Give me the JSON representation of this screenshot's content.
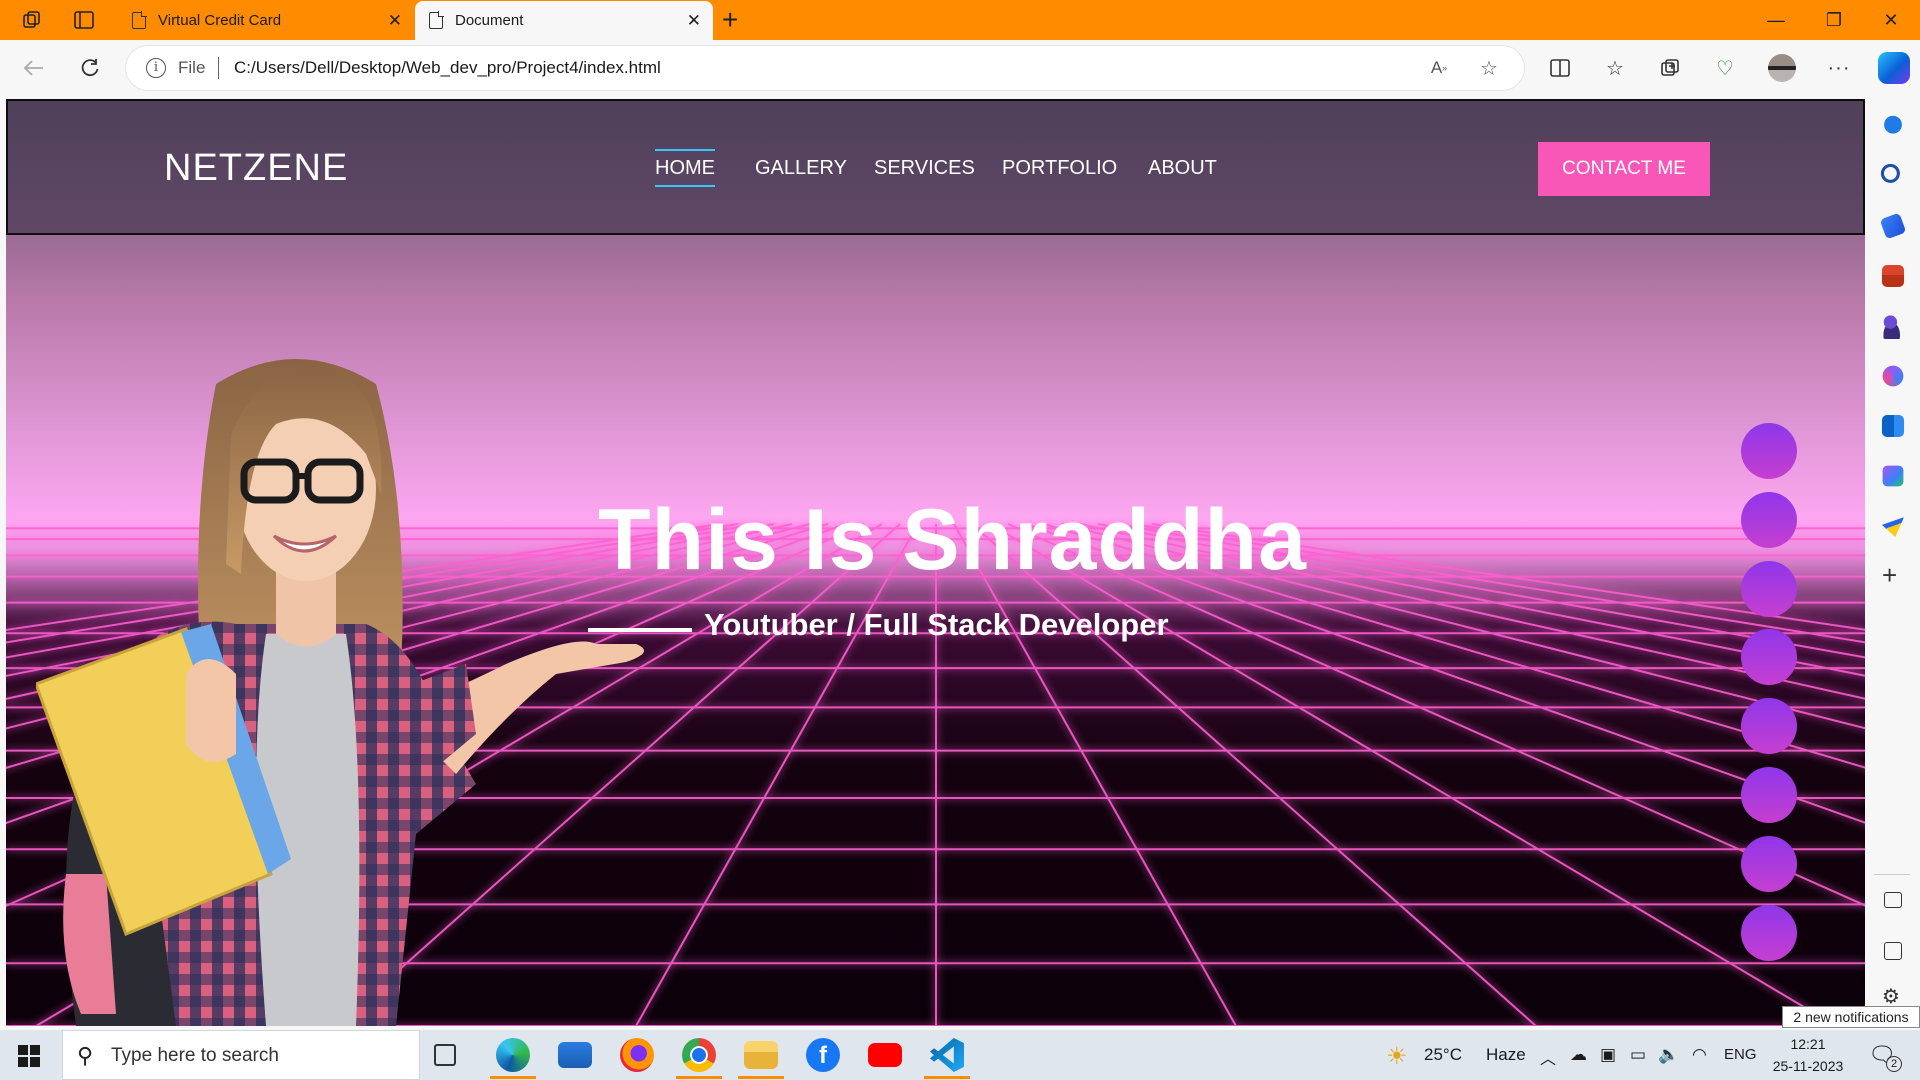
{
  "browser": {
    "tabs": [
      {
        "label": "Virtual Credit Card",
        "active": false
      },
      {
        "label": "Document",
        "active": true
      }
    ],
    "address": {
      "scheme_label": "File",
      "url": "C:/Users/Dell/Desktop/Web_dev_pro/Project4/index.html"
    },
    "toolbar_icons": [
      "read-aloud-icon",
      "favorite-star-icon",
      "split-screen-icon",
      "favorites-icon",
      "collections-icon",
      "browser-essentials-icon",
      "profile-avatar",
      "more-icon",
      "copilot-icon"
    ],
    "sidebar_icons": [
      "bell-icon",
      "search-icon",
      "shopping-tag-icon",
      "tools-icon",
      "games-icon",
      "office-icon",
      "outlook-icon",
      "designer-icon",
      "send-icon",
      "add-icon",
      "sidebar-toggle-icon",
      "external-link-icon",
      "settings-icon"
    ]
  },
  "site": {
    "logo": "NETZENE",
    "menu": [
      {
        "label": "HOME",
        "active": true
      },
      {
        "label": "GALLERY",
        "active": false
      },
      {
        "label": "SERVICES",
        "active": false
      },
      {
        "label": "PORTFOLIO",
        "active": false
      },
      {
        "label": "ABOUT",
        "active": false
      }
    ],
    "cta": "CONTACT ME",
    "hero_title": "This Is Shraddha",
    "hero_subtitle": "Youtuber / Full Stack Developer",
    "dot_count": 8,
    "colors": {
      "accent": "#f957b8",
      "dot_top": "#8f36ea",
      "dot_bottom": "#c63fd0",
      "grid": "#ff5fd2",
      "tab_bar": "#ff8c00"
    }
  },
  "taskbar": {
    "search_placeholder": "Type here to search",
    "apps": [
      "task-view-icon",
      "edge-icon",
      "mail-icon",
      "firefox-icon",
      "chrome-icon",
      "file-explorer-icon",
      "facebook-icon",
      "youtube-icon",
      "vscode-icon"
    ],
    "weather": {
      "temp": "25°C",
      "condition": "Haze"
    },
    "language": "ENG",
    "time": "12:21",
    "date": "25-11-2023",
    "notification_tooltip": "2 new notifications",
    "notification_count": "2"
  }
}
